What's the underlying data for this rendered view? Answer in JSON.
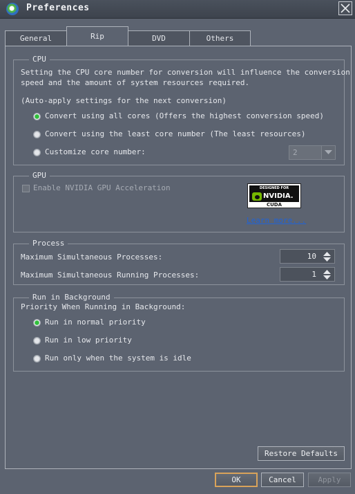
{
  "window": {
    "title": "Preferences"
  },
  "tabs": [
    {
      "label": "General"
    },
    {
      "label": "Rip"
    },
    {
      "label": "DVD"
    },
    {
      "label": "Others"
    }
  ],
  "active_tab": "Rip",
  "cpu": {
    "title": "CPU",
    "description_1": "Setting the CPU core number for conversion will influence the conversion",
    "description_2": "speed and the amount of system resources required.",
    "auto_apply": "(Auto-apply settings for the next conversion)",
    "options": [
      {
        "label": "Convert using all cores (Offers the highest conversion speed)",
        "selected": true
      },
      {
        "label": "Convert using the least core number (The least resources)",
        "selected": false
      },
      {
        "label": "Customize core number:",
        "selected": false
      }
    ],
    "core_select_value": "2"
  },
  "gpu": {
    "title": "GPU",
    "checkbox_label": "Enable NVIDIA GPU Acceleration",
    "badge_top": "DESIGNED FOR",
    "badge_brand": "NVIDIA.",
    "badge_sub": "CUDA",
    "link": "Learn more..."
  },
  "process": {
    "title": "Process",
    "max_processes_label": "Maximum Simultaneous Processes:",
    "max_processes_value": "10",
    "max_running_label": "Maximum Simultaneous Running Processes:",
    "max_running_value": "1"
  },
  "background": {
    "title": "Run in Background",
    "priority_label": "Priority When Running in Background:",
    "options": [
      {
        "label": "Run in normal priority",
        "selected": true
      },
      {
        "label": "Run in low priority",
        "selected": false
      },
      {
        "label": "Run only when the system is idle",
        "selected": false
      }
    ]
  },
  "buttons": {
    "restore": "Restore Defaults",
    "ok": "OK",
    "cancel": "Cancel",
    "apply": "Apply"
  },
  "colors": {
    "accent_ok_border": "#d9a35a",
    "radio_selected": "#2fbf3a",
    "link": "#1f63d8"
  }
}
